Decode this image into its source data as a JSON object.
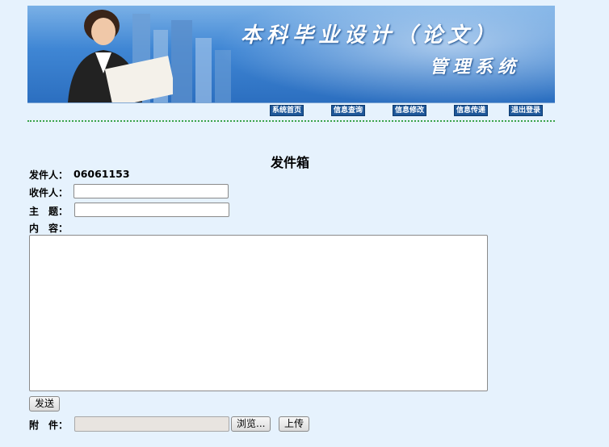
{
  "banner": {
    "title": "本科毕业设计（论文）",
    "subtitle": "管理系统"
  },
  "nav": {
    "items": [
      {
        "label": "系统首页"
      },
      {
        "label": "信息查询"
      },
      {
        "label": "信息修改"
      },
      {
        "label": "信息传递"
      },
      {
        "label": "退出登录"
      }
    ]
  },
  "page": {
    "title": "发件箱"
  },
  "form": {
    "sender_label": "发件人：",
    "sender_value": "06061153",
    "recipient_label": "收件人：",
    "recipient_value": "",
    "subject_label": "主　题：",
    "subject_value": "",
    "content_label": "内　容：",
    "content_value": "",
    "send_label": "发送",
    "attachment_label": "附　件：",
    "browse_label": "浏览...",
    "upload_label": "上传"
  }
}
